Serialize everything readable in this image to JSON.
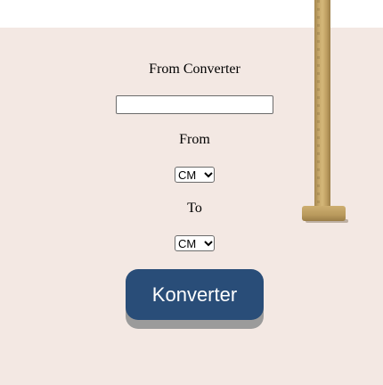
{
  "converter": {
    "title": "From Converter",
    "value_input": "",
    "from_label": "From",
    "from_unit": "CM",
    "to_label": "To",
    "to_unit": "CM",
    "convert_label": "Konverter"
  },
  "colors": {
    "panel_background": "#f3e8e3",
    "button_background": "#294d78",
    "button_shadow": "#9b9b9b",
    "button_text": "#ffffff"
  },
  "icons": {
    "select_arrow": "chevron-down-icon",
    "decoration": "wooden-pole-image"
  }
}
